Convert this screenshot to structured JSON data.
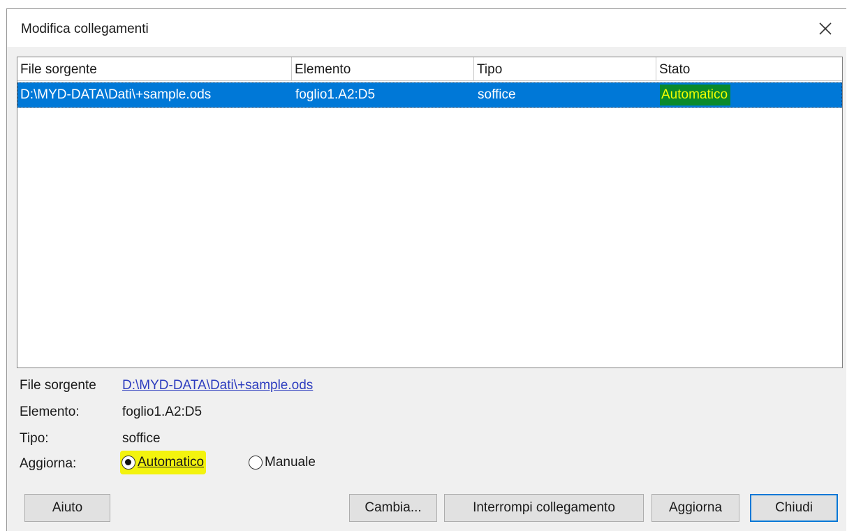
{
  "dialog": {
    "title": "Modifica collegamenti"
  },
  "list": {
    "headers": [
      "File sorgente",
      "Elemento",
      "Tipo",
      "Stato"
    ],
    "rows": [
      {
        "file": "D:\\MYD-DATA\\Dati\\+sample.ods",
        "element": "foglio1.A2:D5",
        "type": "soffice",
        "status": "Automatico"
      }
    ]
  },
  "details": {
    "file_label": "File sorgente",
    "file_value": "D:\\MYD-DATA\\Dati\\+sample.ods",
    "element_label": "Elemento:",
    "element_value": "foglio1.A2:D5",
    "type_label": "Tipo:",
    "type_value": "soffice",
    "update_label": "Aggiorna:",
    "options": [
      {
        "label": "Automatico",
        "selected": true
      },
      {
        "label": "Manuale",
        "selected": false
      }
    ]
  },
  "buttons": {
    "help": "Aiuto",
    "change": "Cambia...",
    "break_link": "Interrompi collegamento",
    "update": "Aggiorna",
    "close": "Chiudi"
  },
  "colors": {
    "selection": "#0078d7",
    "highlight_yellow": "#f3f30e",
    "highlight_green": "#0a8a2a",
    "link": "#2d3dbf"
  }
}
